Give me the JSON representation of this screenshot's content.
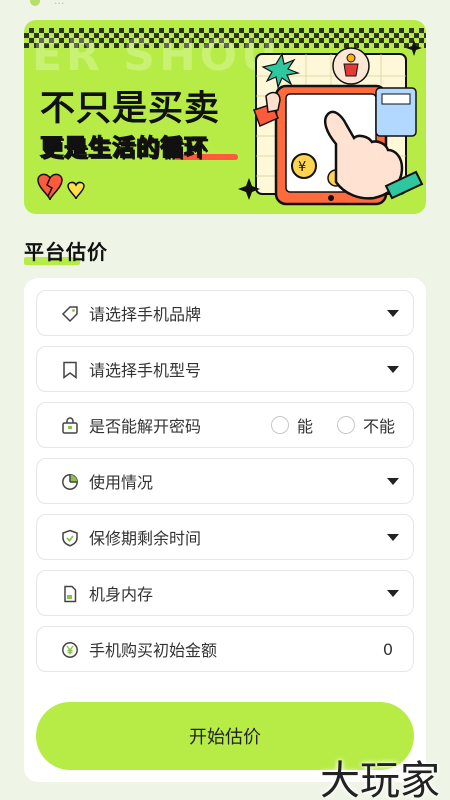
{
  "top_hint": "...",
  "banner": {
    "ghost_text": "ER SHOU",
    "headline_line1": "不只是买卖",
    "headline_line2": "更是生活的循环",
    "colors": {
      "bg": "#b7ec46",
      "accent": "#ff5a3c"
    }
  },
  "section": {
    "title": "平台估价"
  },
  "form": {
    "rows": [
      {
        "label": "请选择手机品牌",
        "icon": "tag-icon",
        "control": "dropdown"
      },
      {
        "label": "请选择手机型号",
        "icon": "bookmark-icon",
        "control": "dropdown"
      },
      {
        "label": "是否能解开密码",
        "icon": "lock-icon",
        "control": "radio",
        "options": [
          "能",
          "不能"
        ]
      },
      {
        "label": "使用情况",
        "icon": "pie-chart-icon",
        "control": "dropdown"
      },
      {
        "label": "保修期剩余时间",
        "icon": "shield-icon",
        "control": "dropdown"
      },
      {
        "label": "机身内存",
        "icon": "sd-card-icon",
        "control": "dropdown"
      },
      {
        "label": "手机购买初始金额",
        "icon": "yen-coin-icon",
        "control": "value",
        "value": "0"
      }
    ],
    "submit_label": "开始估价"
  },
  "watermark": "大玩家",
  "colors": {
    "accent": "#b7ec46",
    "page_bg": "#eef5e6",
    "icon_green": "#8bc34a"
  }
}
